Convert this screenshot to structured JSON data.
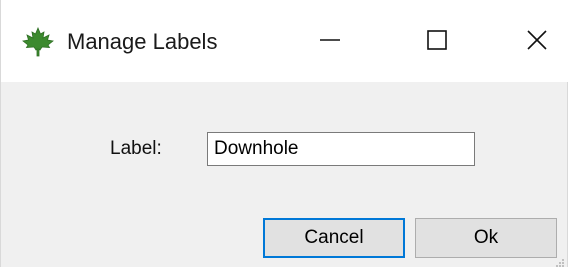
{
  "window": {
    "title": "Manage Labels",
    "icon": "maple-leaf-icon",
    "controls": {
      "minimize_icon": "minimize-icon",
      "maximize_icon": "maximize-icon",
      "close_icon": "close-icon"
    }
  },
  "form": {
    "label_text": "Label:",
    "label_value": "Downhole"
  },
  "buttons": {
    "cancel_label": "Cancel",
    "ok_label": "Ok"
  },
  "colors": {
    "icon_green": "#3c8a2e",
    "focus_border": "#0078d7",
    "button_face": "#e1e1e1",
    "dialog_background": "#f0f0f0"
  }
}
